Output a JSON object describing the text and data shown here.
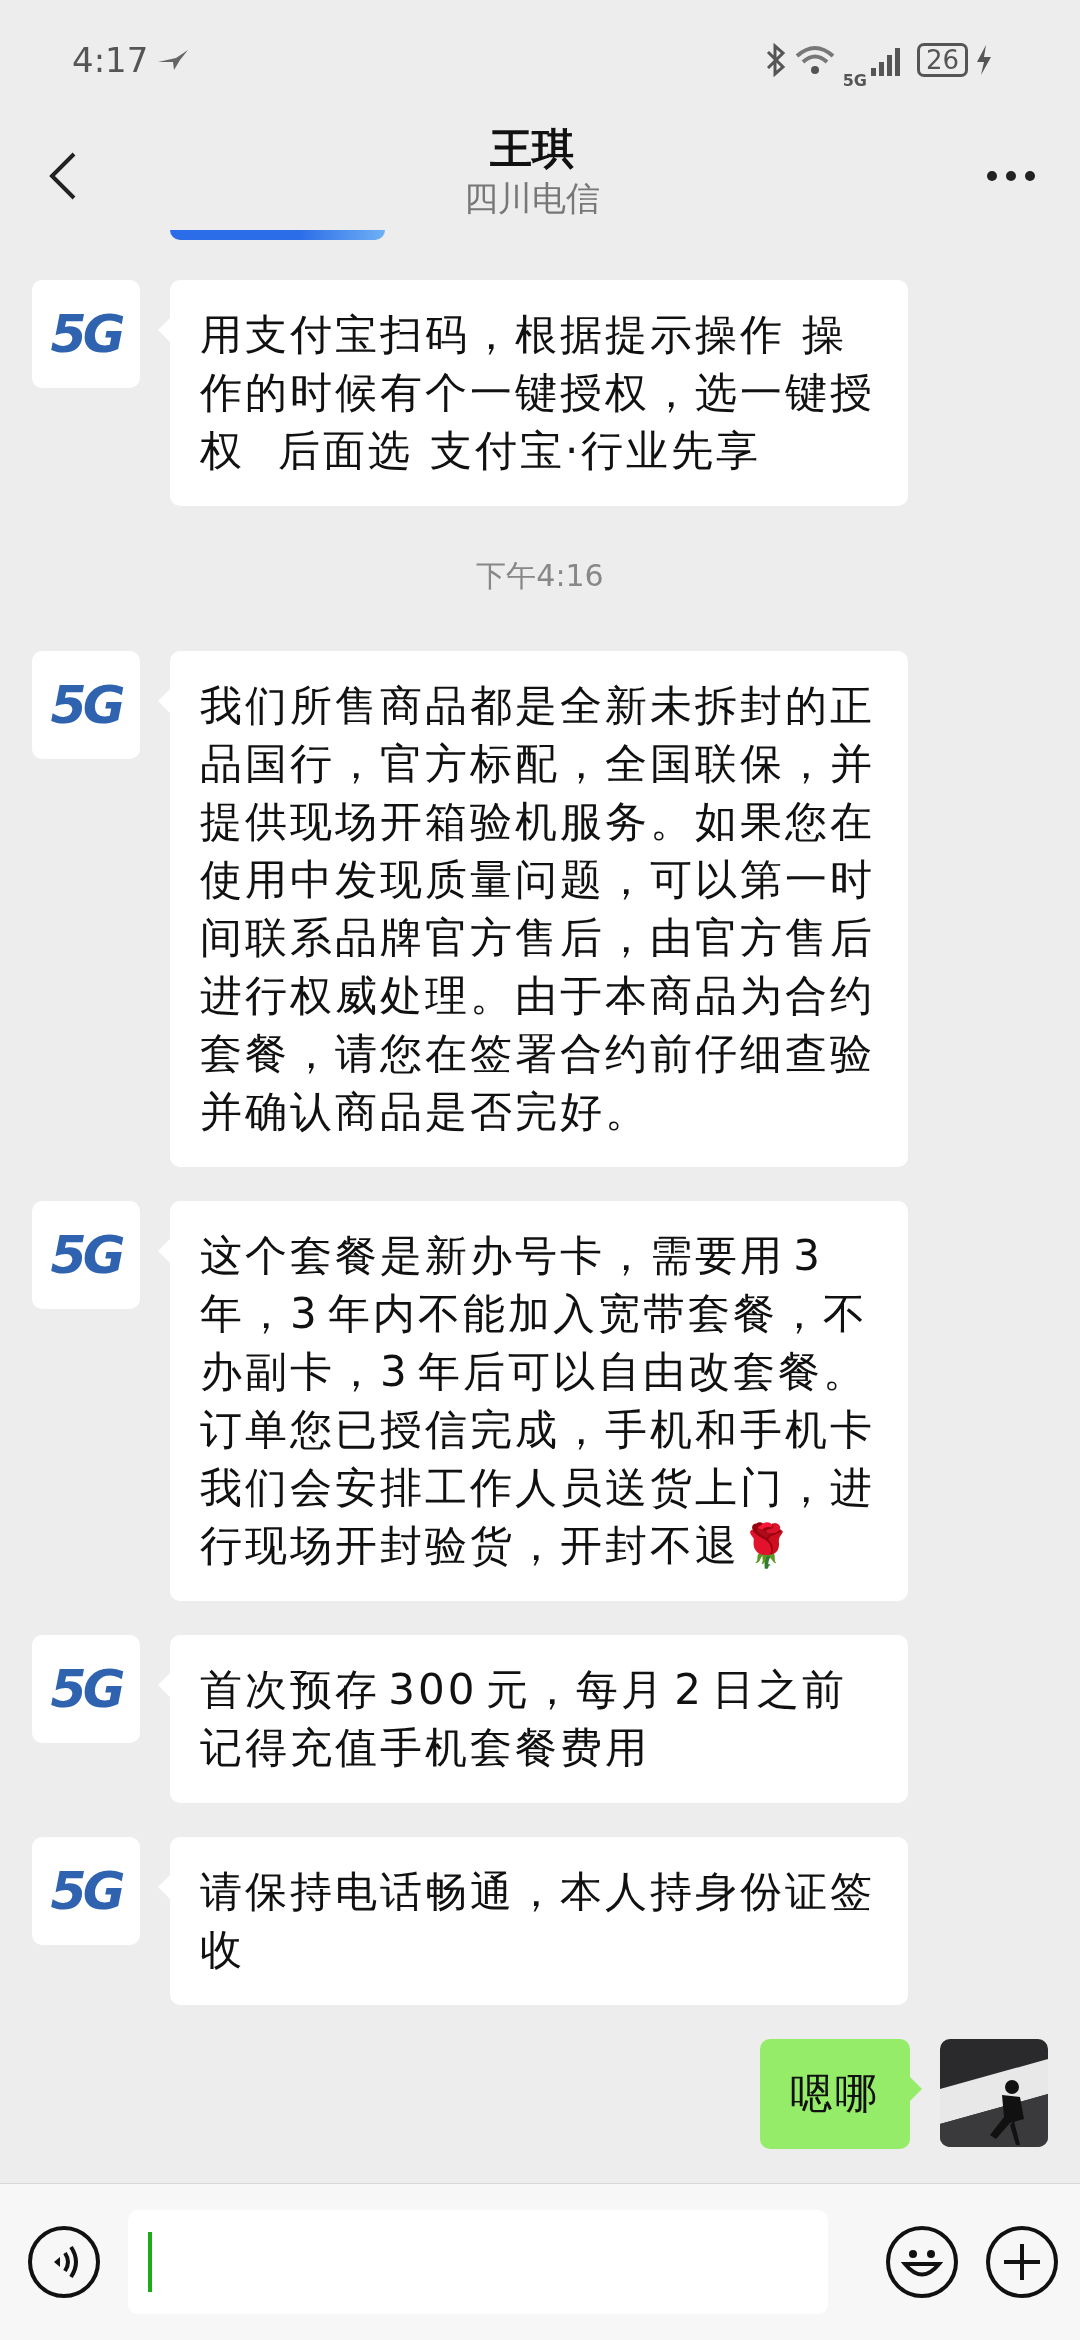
{
  "status_bar": {
    "time": "4:17",
    "network": "5G",
    "battery": "26"
  },
  "header": {
    "title": "王琪",
    "subtitle": "四川电信"
  },
  "messages": [
    {
      "kind": "clipped_card"
    },
    {
      "kind": "text",
      "outgoing": false,
      "avatar": {
        "kind": "logo",
        "text": "5G"
      },
      "text": "用支付宝扫码，根据提示操作  操作的时候有个一键授权，选一键授权    后面选  支付宝·行业先享"
    },
    {
      "kind": "time",
      "text": "下午4:16"
    },
    {
      "kind": "text",
      "outgoing": false,
      "avatar": {
        "kind": "logo",
        "text": "5G"
      },
      "text": "我们所售商品都是全新未拆封的正品国行，官方标配，全国联保，并提供现场开箱验机服务。如果您在使用中发现质量问题，可以第一时间联系品牌官方售后，由官方售后进行权威处理。由于本商品为合约套餐，请您在签署合约前仔细查验并确认商品是否完好。"
    },
    {
      "kind": "text",
      "outgoing": false,
      "avatar": {
        "kind": "logo",
        "text": "5G"
      },
      "text": "这个套餐是新办号卡，需要用 3 年，3 年内不能加入宽带套餐，不办副卡，3 年后可以自由改套餐。订单您已授信完成，手机和手机卡我们会安排工作人员送货上门，进行现场开封验货，开封不退🌹"
    },
    {
      "kind": "text",
      "outgoing": false,
      "avatar": {
        "kind": "logo",
        "text": "5G"
      },
      "text": "首次预存 300 元，每月 2 日之前记得充值手机套餐费用"
    },
    {
      "kind": "text",
      "outgoing": false,
      "avatar": {
        "kind": "logo",
        "text": "5G"
      },
      "text": "请保持电话畅通，本人持身份证签收"
    },
    {
      "kind": "text",
      "outgoing": true,
      "text": "嗯哪"
    }
  ]
}
